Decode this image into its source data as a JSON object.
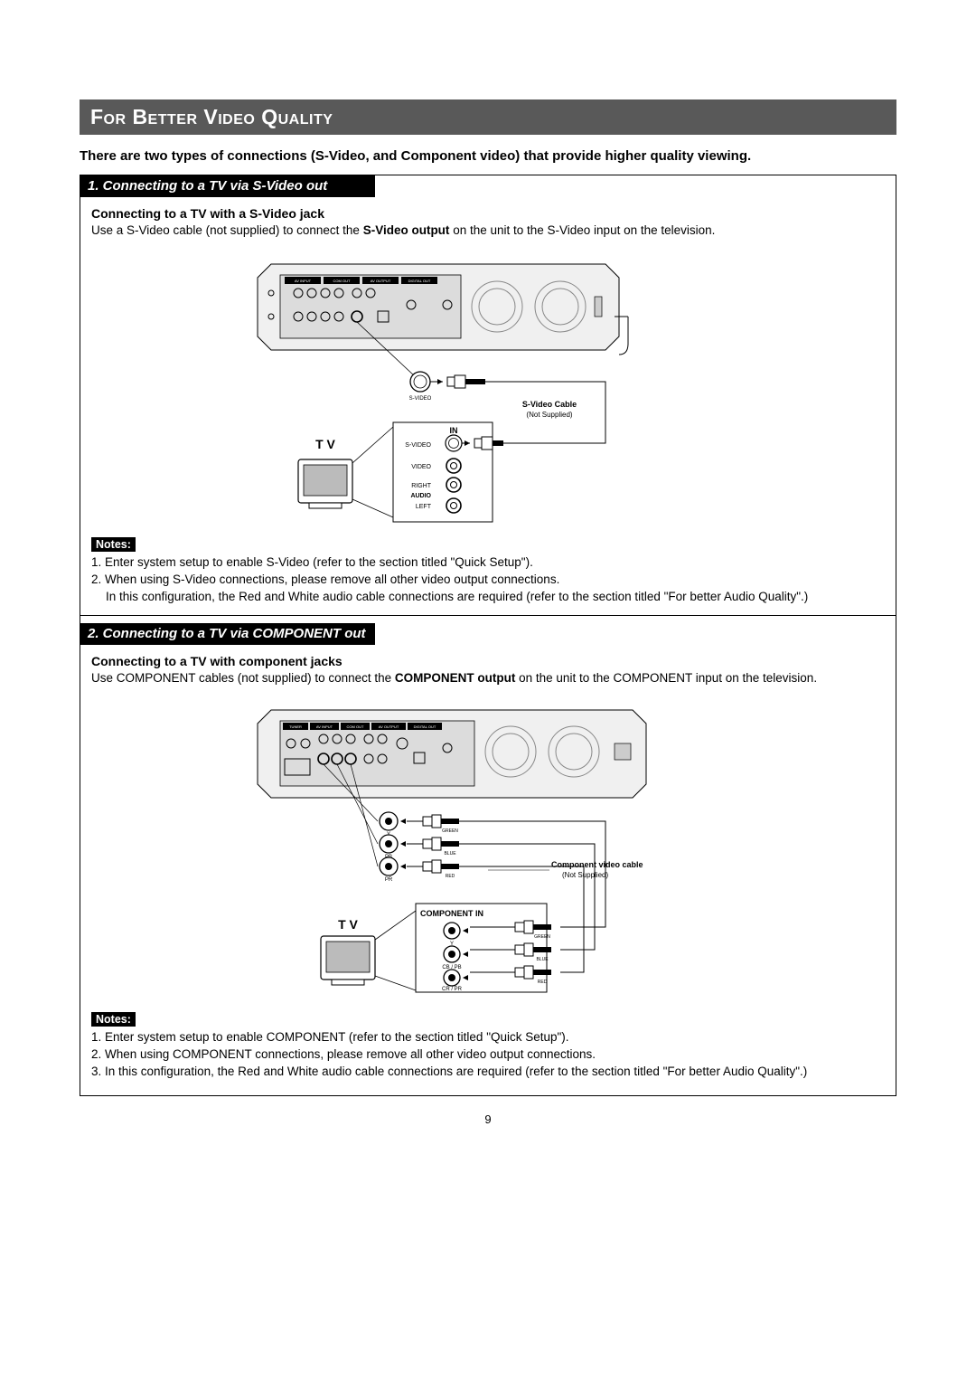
{
  "page_title": "For Better Video Quality",
  "intro": "There are two types of connections (S-Video, and Component video) that provide higher quality viewing.",
  "section1": {
    "heading": "1. Connecting to a TV  via S-Video out",
    "subheading": "Connecting to a TV with a S-Video jack",
    "body_pre": "Use a S-Video cable (not supplied) to connect the ",
    "body_bold": "S-Video output",
    "body_post": " on the unit to the S-Video input on the television.",
    "notes_label": "Notes:",
    "notes": [
      "1. Enter system setup to enable S-Video (refer to the section titled \"Quick Setup\").",
      "2. When using S-Video connections, please remove all other video output connections.",
      "In this configuration, the Red and White audio cable connections are required (refer to the section titled \"For better Audio Quality\".)"
    ],
    "diagram": {
      "cable_label": "S-Video Cable",
      "cable_sub": "(Not Supplied)",
      "svideo_label": "S-VIDEO",
      "tv_label": "T V",
      "in_label": "IN",
      "ports": [
        "S-VIDEO",
        "VIDEO",
        "RIGHT",
        "AUDIO",
        "LEFT"
      ],
      "unit_panel_groups": [
        "AV INPUT",
        "COM OUT",
        "AV OUTPUT",
        "DIGITAL OUT"
      ]
    }
  },
  "section2": {
    "heading": "2. Connecting to a TV  via COMPONENT out",
    "subheading": "Connecting to a TV with component jacks",
    "body_pre": "Use COMPONENT cables (not supplied) to connect the ",
    "body_bold": "COMPONENT output",
    "body_post": " on the unit to the COMPONENT  input on the television.",
    "notes_label": "Notes:",
    "notes": [
      "1. Enter system setup to enable COMPONENT (refer to the section titled \"Quick Setup\").",
      "2. When using COMPONENT  connections, please remove all other video output connections.",
      "3. In this configuration, the Red and White audio cable connections are required (refer to the section titled \"For better Audio Quality\".)"
    ],
    "diagram": {
      "cable_label": "Component video cable",
      "cable_sub": "(Not Supplied)",
      "tv_label": "T V",
      "component_in": "COMPONENT IN",
      "unit_ports": [
        "Y",
        "PB",
        "PR"
      ],
      "tv_ports": [
        "Y",
        "CB / PB",
        "CR / PR"
      ],
      "colors": [
        "GREEN",
        "BLUE",
        "RED"
      ],
      "unit_panel_groups": [
        "TUNER",
        "AV INPUT",
        "COM OUT",
        "AV OUTPUT",
        "DIGITAL OUT"
      ]
    }
  },
  "page_number": "9"
}
